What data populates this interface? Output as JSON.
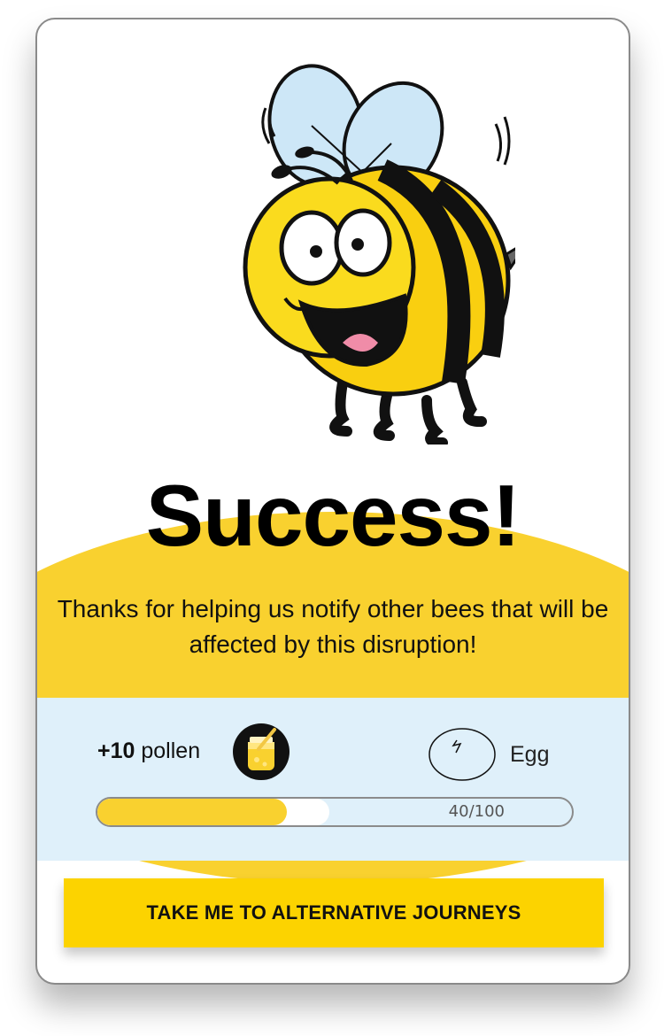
{
  "success": {
    "title": "Success!",
    "message": "Thanks for helping us notify other bees that will be affected by this disruption!"
  },
  "reward": {
    "points": "+10",
    "unit": "pollen",
    "jar_icon": "honey-jar-icon",
    "next_level_icon": "cracked-egg-icon",
    "next_level_label": "Egg",
    "progress_current": 40,
    "progress_max": 100,
    "progress_text": "40/100"
  },
  "cta": {
    "label": "TAKE ME TO ALTERNATIVE JOURNEYS"
  },
  "colors": {
    "accent_yellow": "#f9d12f",
    "button_yellow": "#fcd300",
    "panel_blue": "#dff0fa"
  }
}
